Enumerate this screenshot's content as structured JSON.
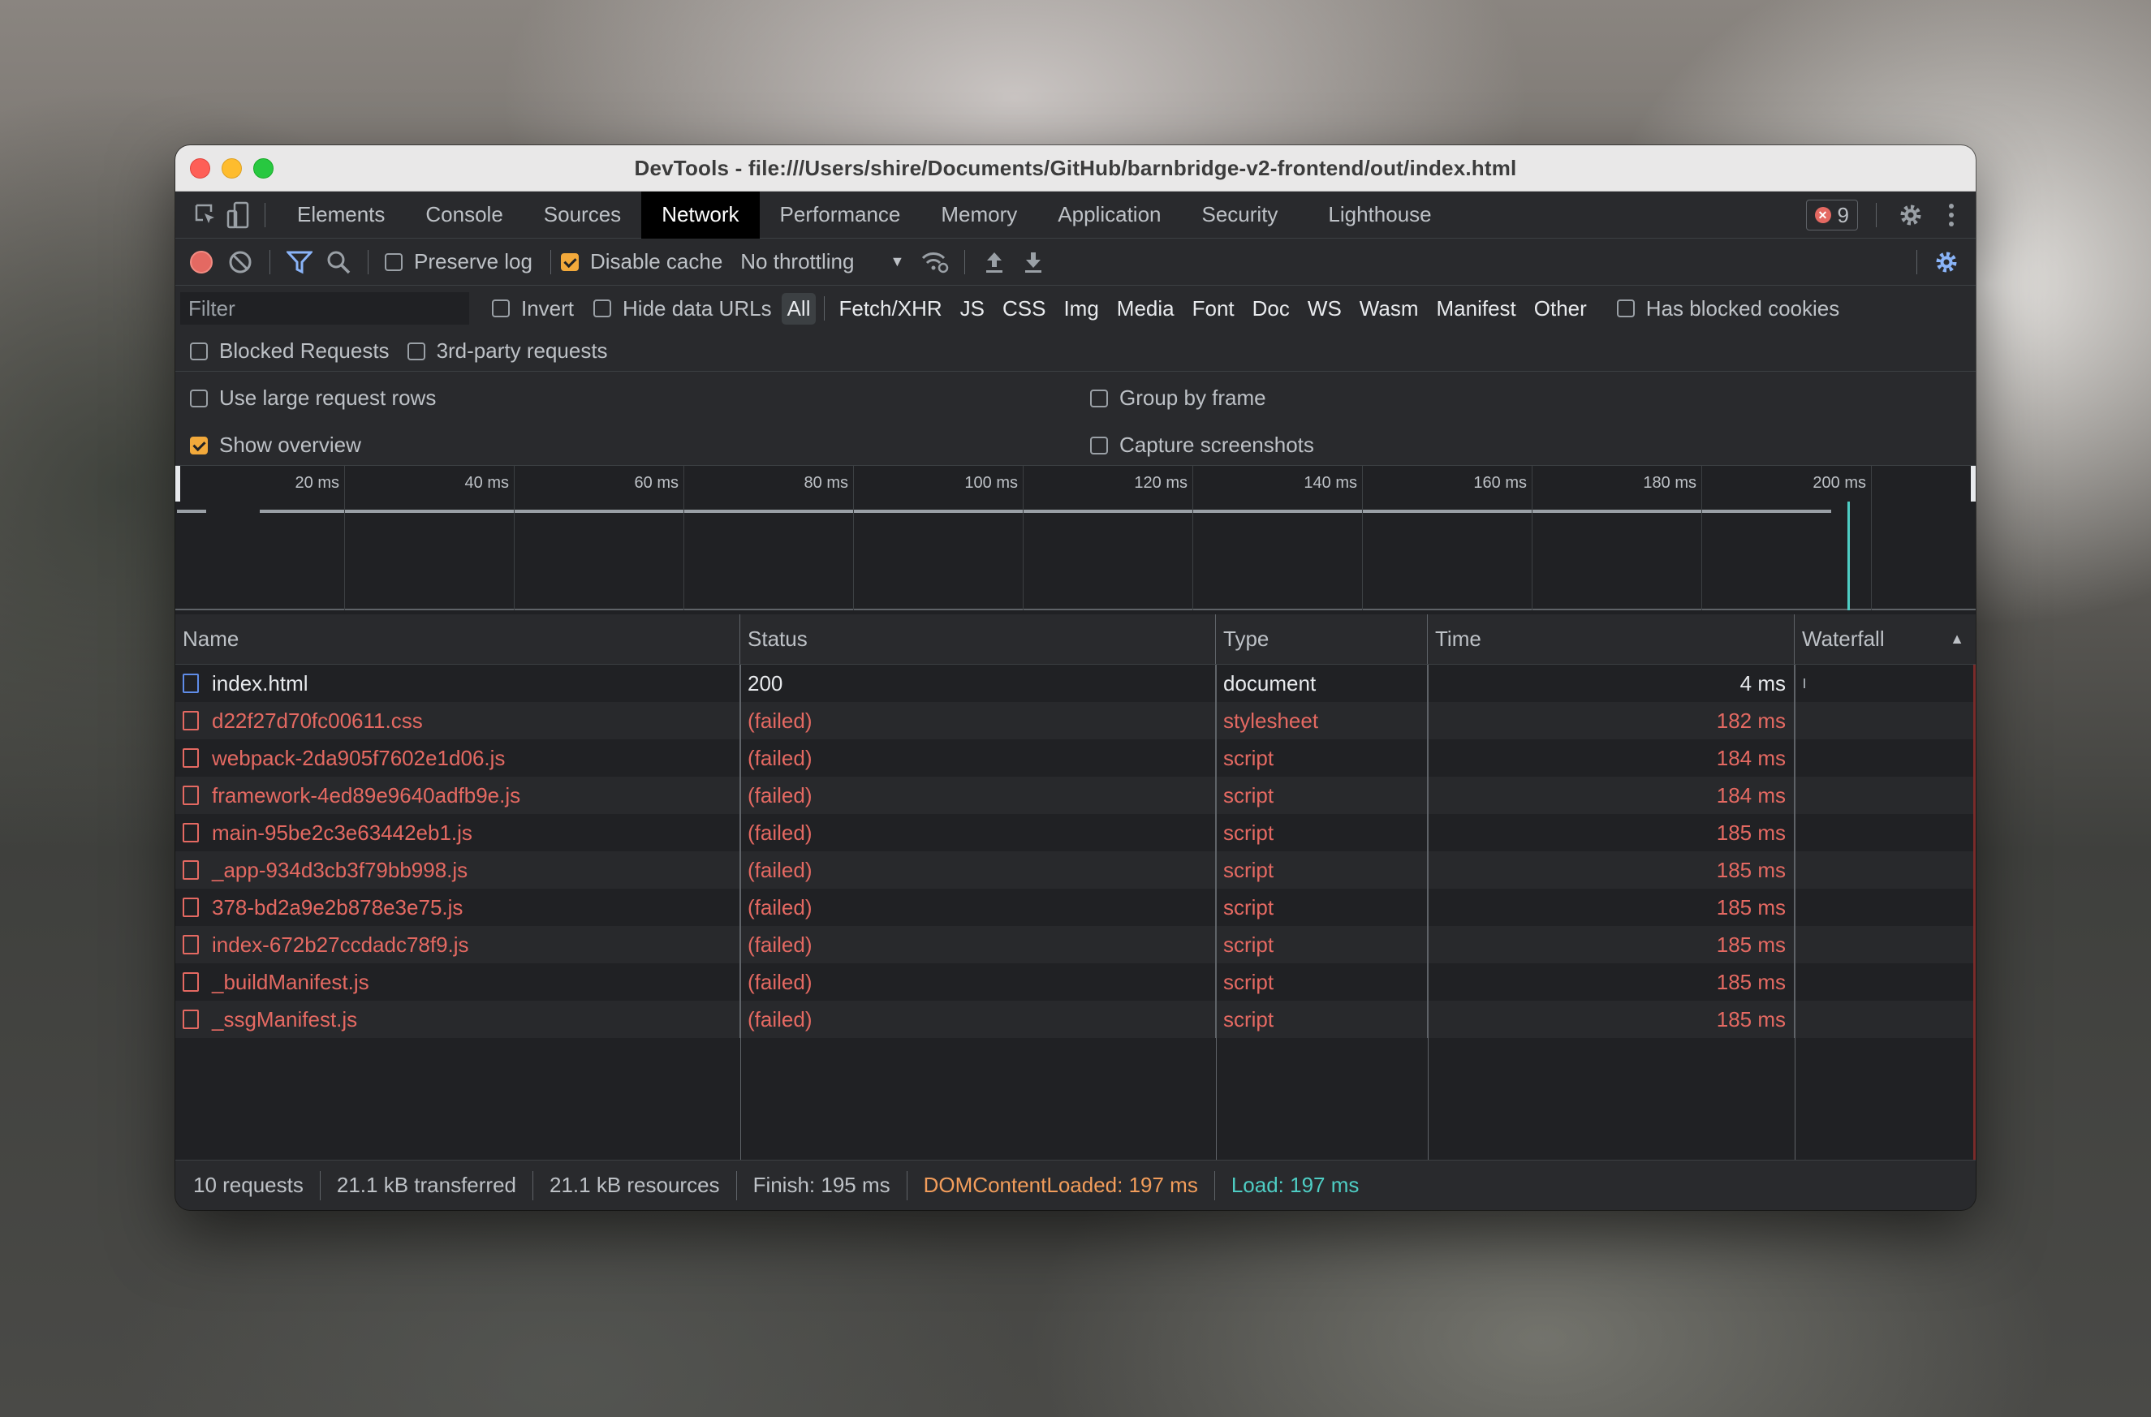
{
  "window": {
    "title": "DevTools - file:///Users/shire/Documents/GitHub/barnbridge-v2-frontend/out/index.html"
  },
  "tabs": [
    "Elements",
    "Console",
    "Sources",
    "Network",
    "Performance",
    "Memory",
    "Application",
    "Security",
    "Lighthouse"
  ],
  "active_tab": "Network",
  "error_count": "9",
  "toolbar": {
    "preserve_log": {
      "label": "Preserve log",
      "checked": false
    },
    "disable_cache": {
      "label": "Disable cache",
      "checked": true
    },
    "throttling": "No throttling"
  },
  "filter": {
    "placeholder": "Filter",
    "invert": "Invert",
    "hide_data_urls": "Hide data URLs",
    "types": [
      "All",
      "Fetch/XHR",
      "JS",
      "CSS",
      "Img",
      "Media",
      "Font",
      "Doc",
      "WS",
      "Wasm",
      "Manifest",
      "Other"
    ],
    "active_type": "All",
    "has_blocked_cookies": "Has blocked cookies",
    "blocked_requests": "Blocked Requests",
    "third_party": "3rd-party requests"
  },
  "settings": {
    "large_rows": {
      "label": "Use large request rows",
      "checked": false
    },
    "show_overview": {
      "label": "Show overview",
      "checked": true
    },
    "group_by_frame": {
      "label": "Group by frame",
      "checked": false
    },
    "capture_screenshots": {
      "label": "Capture screenshots",
      "checked": false
    }
  },
  "overview": {
    "ticks": [
      "20 ms",
      "40 ms",
      "60 ms",
      "80 ms",
      "100 ms",
      "120 ms",
      "140 ms",
      "160 ms",
      "180 ms",
      "200 ms"
    ]
  },
  "table": {
    "headers": {
      "name": "Name",
      "status": "Status",
      "type": "Type",
      "time": "Time",
      "waterfall": "Waterfall"
    },
    "rows": [
      {
        "name": "index.html",
        "status": "200",
        "type": "document",
        "time": "4 ms",
        "icon": "document-icon",
        "failed": false
      },
      {
        "name": "d22f27d70fc00611.css",
        "status": "(failed)",
        "type": "stylesheet",
        "time": "182 ms",
        "icon": "stylesheet-icon",
        "failed": true
      },
      {
        "name": "webpack-2da905f7602e1d06.js",
        "status": "(failed)",
        "type": "script",
        "time": "184 ms",
        "icon": "script-icon",
        "failed": true
      },
      {
        "name": "framework-4ed89e9640adfb9e.js",
        "status": "(failed)",
        "type": "script",
        "time": "184 ms",
        "icon": "script-icon",
        "failed": true
      },
      {
        "name": "main-95be2c3e63442eb1.js",
        "status": "(failed)",
        "type": "script",
        "time": "185 ms",
        "icon": "script-icon",
        "failed": true
      },
      {
        "name": "_app-934d3cb3f79bb998.js",
        "status": "(failed)",
        "type": "script",
        "time": "185 ms",
        "icon": "script-icon",
        "failed": true
      },
      {
        "name": "378-bd2a9e2b878e3e75.js",
        "status": "(failed)",
        "type": "script",
        "time": "185 ms",
        "icon": "script-icon",
        "failed": true
      },
      {
        "name": "index-672b27ccdadc78f9.js",
        "status": "(failed)",
        "type": "script",
        "time": "185 ms",
        "icon": "script-icon",
        "failed": true
      },
      {
        "name": "_buildManifest.js",
        "status": "(failed)",
        "type": "script",
        "time": "185 ms",
        "icon": "script-icon",
        "failed": true
      },
      {
        "name": "_ssgManifest.js",
        "status": "(failed)",
        "type": "script",
        "time": "185 ms",
        "icon": "script-icon",
        "failed": true
      }
    ]
  },
  "status": {
    "requests": "10 requests",
    "transferred": "21.1 kB transferred",
    "resources": "21.1 kB resources",
    "finish": "Finish: 195 ms",
    "dom_content_loaded": "DOMContentLoaded: 197 ms",
    "load": "Load: 197 ms"
  },
  "colors": {
    "failed": "#e46962",
    "accent": "#8ab4f8",
    "dcl": "#f29d5b",
    "load": "#4ecdc4",
    "checkbox": "#f2a93b"
  }
}
